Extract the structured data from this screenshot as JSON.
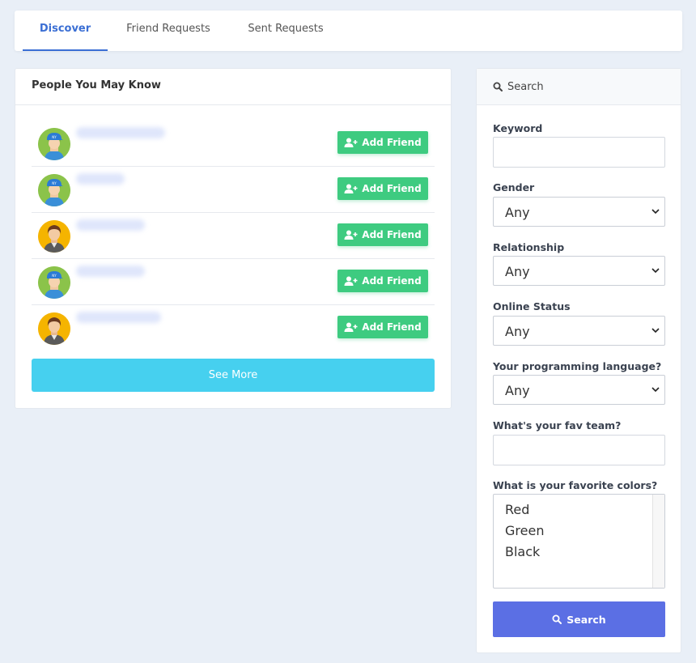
{
  "tabs": [
    {
      "label": "Discover",
      "active": true
    },
    {
      "label": "Friend Requests",
      "active": false
    },
    {
      "label": "Sent Requests",
      "active": false
    }
  ],
  "people": {
    "title": "People You May Know",
    "rows": [
      {
        "avatar": "avatar-icon-woman-cap",
        "button": "Add Friend"
      },
      {
        "avatar": "avatar-icon-woman-cap",
        "button": "Add Friend"
      },
      {
        "avatar": "avatar-icon-man",
        "button": "Add Friend"
      },
      {
        "avatar": "avatar-icon-woman-cap",
        "button": "Add Friend"
      },
      {
        "avatar": "avatar-icon-man",
        "button": "Add Friend"
      }
    ],
    "see_more": "See More"
  },
  "search": {
    "header": "Search",
    "keyword_label": "Keyword",
    "keyword_value": "",
    "gender_label": "Gender",
    "gender_value": "Any",
    "relationship_label": "Relationship",
    "relationship_value": "Any",
    "online_label": "Online Status",
    "online_value": "Any",
    "language_label": "Your programming language?",
    "language_value": "Any",
    "team_label": "What's your fav team?",
    "team_value": "",
    "colors_label": "What is your favorite colors?",
    "colors_options": [
      "Red",
      "Green",
      "Black"
    ],
    "button": "Search"
  },
  "colors": {
    "accent": "#3b6fd4",
    "add_friend": "#3ecb80",
    "see_more": "#46d0ef",
    "search_button": "#5b6fe4",
    "background": "#e9eff7"
  }
}
